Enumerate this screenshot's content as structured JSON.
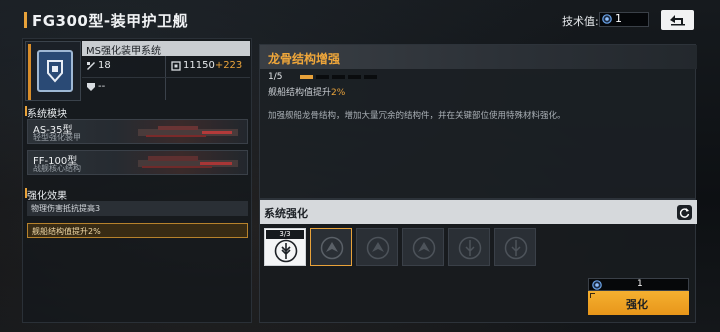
{
  "header": {
    "title": "FG300型-装甲护卫舰",
    "tech_label": "技术值:",
    "tech_value": "1"
  },
  "system": {
    "name": "MS强化装甲系统",
    "stat_a": "18",
    "stat_b_base": "11150",
    "stat_b_bonus": "+223",
    "stat_c": "--"
  },
  "modules_section": {
    "heading": "系统模块",
    "items": [
      {
        "name": "AS-35型",
        "sub": "轻型强化装甲"
      },
      {
        "name": "FF-100型",
        "sub": "战舰核心结构"
      }
    ]
  },
  "effects_section": {
    "heading": "强化效果",
    "items": [
      {
        "text": "物理伤害抵抗提高3"
      },
      {
        "text": "舰船结构值提升2%"
      }
    ]
  },
  "detail": {
    "title": "龙骨结构增强",
    "level": "1/5",
    "level_current": 1,
    "level_max": 5,
    "line_prefix": "舰船结构值提升",
    "line_value": "2%",
    "description": "加强舰船龙骨结构，增加大量冗余的结构件，并在关键部位使用特殊材料强化。"
  },
  "enhance": {
    "title": "系统强化",
    "first_slot_count": "3/3",
    "cost": "1",
    "button_label": "强化"
  },
  "colors": {
    "accent": "#e8a23a",
    "emblem": "#2a4a75"
  }
}
